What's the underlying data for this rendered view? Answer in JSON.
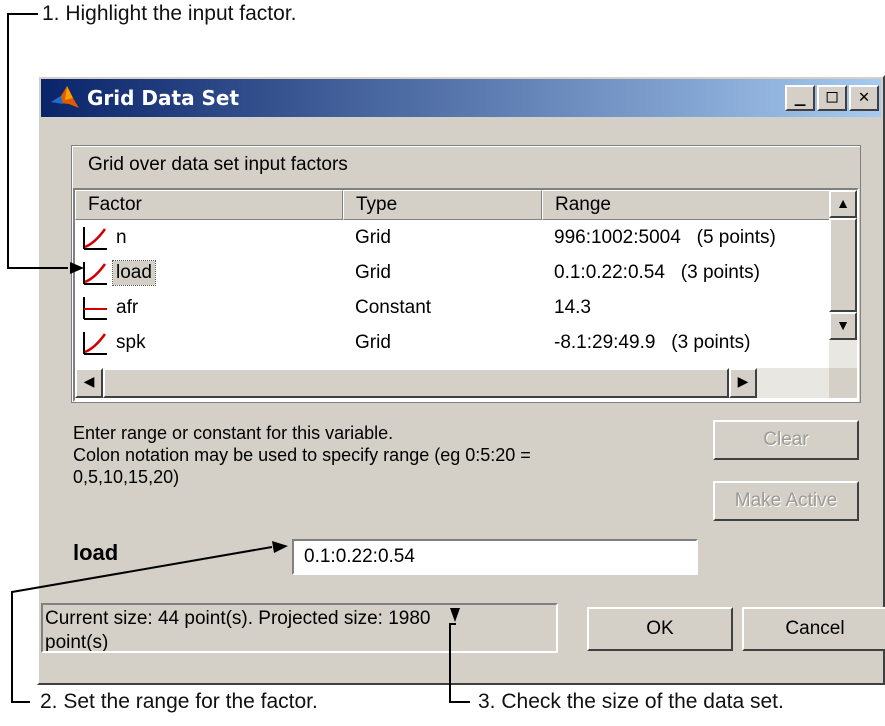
{
  "callouts": {
    "step1": "1. Highlight the input factor.",
    "step2": "2. Set the range for the factor.",
    "step3": "3. Check the size of the data set."
  },
  "window": {
    "title": "Grid Data Set",
    "minimize_glyph": "_",
    "maximize_glyph": "□",
    "close_glyph": "✕"
  },
  "grid_group": {
    "label": "Grid over data set input factors",
    "columns": [
      "Factor",
      "Type",
      "Range"
    ],
    "rows": [
      {
        "factor": "n",
        "type": "Grid",
        "range": "996:1002:5004   (5 points)",
        "icon": "grid-factor-icon",
        "selected": false
      },
      {
        "factor": "load",
        "type": "Grid",
        "range": "0.1:0.22:0.54   (3 points)",
        "icon": "grid-factor-icon",
        "selected": true
      },
      {
        "factor": "afr",
        "type": "Constant",
        "range": "14.3",
        "icon": "constant-factor-icon",
        "selected": false
      },
      {
        "factor": "spk",
        "type": "Grid",
        "range": "-8.1:29:49.9   (3 points)",
        "icon": "grid-factor-icon",
        "selected": false
      }
    ]
  },
  "instructions": {
    "line1": "Enter range or constant for this variable.",
    "line2": "Colon notation may be used to specify range (eg 0:5:20 =",
    "line3": "0,5,10,15,20)"
  },
  "buttons": {
    "clear": "Clear",
    "make_active": "Make Active",
    "ok": "OK",
    "cancel": "Cancel"
  },
  "range_editor": {
    "factor_label": "load",
    "value": "0.1:0.22:0.54"
  },
  "status": {
    "line1": "Current size: 44 point(s).  Projected size: 1980",
    "line2": "point(s)"
  },
  "colors": {
    "title_gradient_start": "#0a246a",
    "title_gradient_end": "#a6caf0",
    "dialog_face": "#d4d0c8",
    "icon_red": "#d00000"
  }
}
